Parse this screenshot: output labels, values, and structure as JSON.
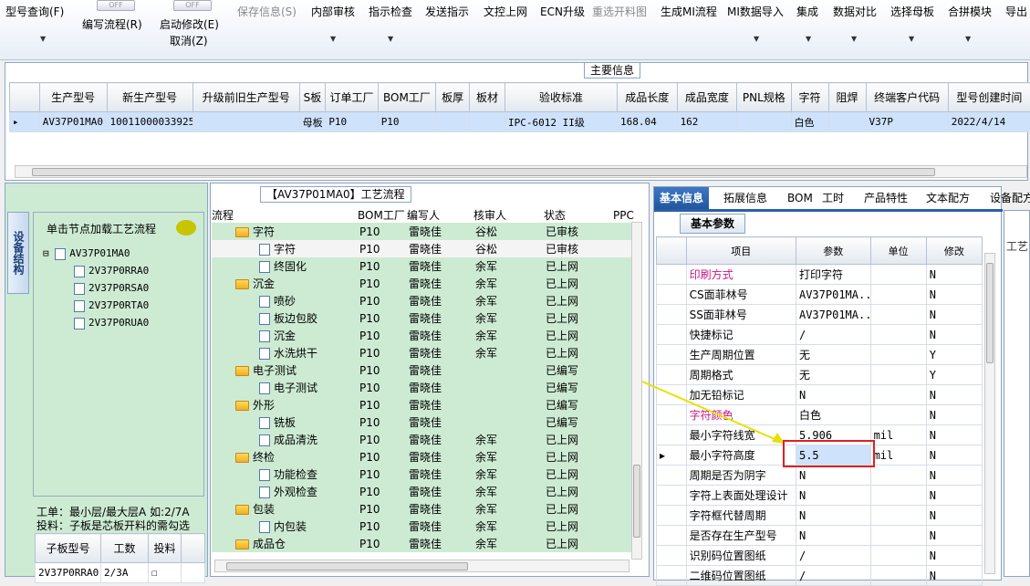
{
  "toolbar": {
    "items": [
      "型号查询(F)",
      "编写流程(R)",
      "启动修改(E)",
      "保存信息(S)",
      "内部审核",
      "指示检查",
      "发送指示",
      "文控上网",
      "ECN升级",
      "重选开料图",
      "生成MI流程",
      "MI数据导入",
      "集成",
      "数据对比",
      "选择母板",
      "合拼模块",
      "导出"
    ],
    "cancel": "取消(Z)",
    "toggle_text": "OFF"
  },
  "main_info": {
    "title": "主要信息",
    "columns": [
      "生产型号",
      "新生产型号",
      "升级前旧生产型号",
      "S板",
      "订单工厂",
      "BOM工厂",
      "板厚",
      "板材",
      "验收标准",
      "成品长度",
      "成品宽度",
      "PNL规格",
      "字符",
      "阻焊",
      "终端客户代码",
      "型号创建时间"
    ],
    "row": [
      "AV37P01MA0",
      "10011000033925",
      "",
      "母板",
      "P10",
      "P10",
      "",
      "",
      "IPC-6012 II级",
      "168.04",
      "162",
      "",
      "白色",
      "",
      "V37P",
      "2022/4/14"
    ]
  },
  "left": {
    "vtab": "设备结构",
    "hint": "单击节点加载工艺流程",
    "tree_root": "AV37P01MA0",
    "tree_children": [
      "2V37P0RRA0",
      "2V37P0RSA0",
      "2V37P0RTA0",
      "2V37P0RUA0"
    ],
    "note1": "工单：最小层/最大层A 如:2/7A",
    "note2": "投料：子板是芯板开料的需勾选",
    "sub_headers": [
      "子板型号",
      "工数",
      "投料"
    ],
    "sub_row": [
      "2V37P0RRA0",
      "2/3A",
      ""
    ]
  },
  "center": {
    "title": "【AV37P01MA0】工艺流程",
    "headers": [
      "流程",
      "BOM工厂",
      "编写人",
      "核审人",
      "状态",
      "PPC"
    ],
    "rows": [
      {
        "name": "字符",
        "folder": true,
        "bom": "P10",
        "writer": "雷晓佳",
        "reviewer": "谷松",
        "status": "已审核"
      },
      {
        "name": "字符",
        "folder": false,
        "bom": "P10",
        "writer": "雷晓佳",
        "reviewer": "谷松",
        "status": "已审核"
      },
      {
        "name": "终固化",
        "folder": false,
        "bom": "P10",
        "writer": "雷晓佳",
        "reviewer": "余军",
        "status": "已上网"
      },
      {
        "name": "沉金",
        "folder": true,
        "bom": "P10",
        "writer": "雷晓佳",
        "reviewer": "余军",
        "status": "已上网"
      },
      {
        "name": "喷砂",
        "folder": false,
        "bom": "P10",
        "writer": "雷晓佳",
        "reviewer": "余军",
        "status": "已上网"
      },
      {
        "name": "板边包胶",
        "folder": false,
        "bom": "P10",
        "writer": "雷晓佳",
        "reviewer": "余军",
        "status": "已上网"
      },
      {
        "name": "沉金",
        "folder": false,
        "bom": "P10",
        "writer": "雷晓佳",
        "reviewer": "余军",
        "status": "已上网"
      },
      {
        "name": "水洗烘干",
        "folder": false,
        "bom": "P10",
        "writer": "雷晓佳",
        "reviewer": "余军",
        "status": "已上网"
      },
      {
        "name": "电子测试",
        "folder": true,
        "bom": "P10",
        "writer": "雷晓佳",
        "reviewer": "",
        "status": "已编写"
      },
      {
        "name": "电子测试",
        "folder": false,
        "bom": "P10",
        "writer": "雷晓佳",
        "reviewer": "",
        "status": "已编写"
      },
      {
        "name": "外形",
        "folder": true,
        "bom": "P10",
        "writer": "雷晓佳",
        "reviewer": "",
        "status": "已编写"
      },
      {
        "name": "铣板",
        "folder": false,
        "bom": "P10",
        "writer": "雷晓佳",
        "reviewer": "",
        "status": "已编写"
      },
      {
        "name": "成品清洗",
        "folder": false,
        "bom": "P10",
        "writer": "雷晓佳",
        "reviewer": "余军",
        "status": "已上网"
      },
      {
        "name": "终检",
        "folder": true,
        "bom": "P10",
        "writer": "雷晓佳",
        "reviewer": "余军",
        "status": "已上网"
      },
      {
        "name": "功能检查",
        "folder": false,
        "bom": "P10",
        "writer": "雷晓佳",
        "reviewer": "余军",
        "status": "已上网"
      },
      {
        "name": "外观检查",
        "folder": false,
        "bom": "P10",
        "writer": "雷晓佳",
        "reviewer": "余军",
        "status": "已上网"
      },
      {
        "name": "包装",
        "folder": true,
        "bom": "P10",
        "writer": "雷晓佳",
        "reviewer": "余军",
        "status": "已上网"
      },
      {
        "name": "内包装",
        "folder": false,
        "bom": "P10",
        "writer": "雷晓佳",
        "reviewer": "余军",
        "status": "已上网"
      },
      {
        "name": "成品仓",
        "folder": true,
        "bom": "P10",
        "writer": "雷晓佳",
        "reviewer": "余军",
        "status": "已上网"
      }
    ]
  },
  "right": {
    "tabs": [
      "基本信息",
      "拓展信息",
      "BOM",
      "工时",
      "产品特性",
      "文本配方",
      "设备配方"
    ],
    "subtab": "基本参数",
    "headers": [
      "项目",
      "参数",
      "单位",
      "修改"
    ],
    "rows": [
      {
        "item": "印刷方式",
        "value": "打印字符",
        "unit": "",
        "mod": "N",
        "hl": true
      },
      {
        "item": "CS面菲林号",
        "value": "AV37P01MA...",
        "unit": "",
        "mod": "N",
        "hl": false
      },
      {
        "item": "SS面菲林号",
        "value": "AV37P01MA...",
        "unit": "",
        "mod": "N",
        "hl": false
      },
      {
        "item": "快捷标记",
        "value": "/",
        "unit": "",
        "mod": "N",
        "hl": false
      },
      {
        "item": "生产周期位置",
        "value": "无",
        "unit": "",
        "mod": "Y",
        "hl": false
      },
      {
        "item": "周期格式",
        "value": "无",
        "unit": "",
        "mod": "Y",
        "hl": false
      },
      {
        "item": "加无铅标记",
        "value": "N",
        "unit": "",
        "mod": "N",
        "hl": false
      },
      {
        "item": "字符颜色",
        "value": "白色",
        "unit": "",
        "mod": "N",
        "hl": true
      },
      {
        "item": "最小字符线宽",
        "value": "5.906",
        "unit": "mil",
        "mod": "N",
        "hl": false
      },
      {
        "item": "最小字符高度",
        "value": "5.5",
        "unit": "mil",
        "mod": "N",
        "hl": false
      },
      {
        "item": "周期是否为阴字",
        "value": "N",
        "unit": "",
        "mod": "N",
        "hl": false
      },
      {
        "item": "字符上表面处理设计",
        "value": "N",
        "unit": "",
        "mod": "N",
        "hl": false
      },
      {
        "item": "字符框代替周期",
        "value": "N",
        "unit": "",
        "mod": "N",
        "hl": false
      },
      {
        "item": "是否存在生产型号",
        "value": "N",
        "unit": "",
        "mod": "N",
        "hl": false
      },
      {
        "item": "识别码位置图纸",
        "value": "/",
        "unit": "",
        "mod": "N",
        "hl": false
      },
      {
        "item": "二维码位置图纸",
        "value": "/",
        "unit": "",
        "mod": "N",
        "hl": false
      }
    ],
    "side_tab": "工艺"
  },
  "colors": {
    "accent": "#2a5fa8",
    "highlight": "#c71585",
    "annot": "#e02020"
  }
}
